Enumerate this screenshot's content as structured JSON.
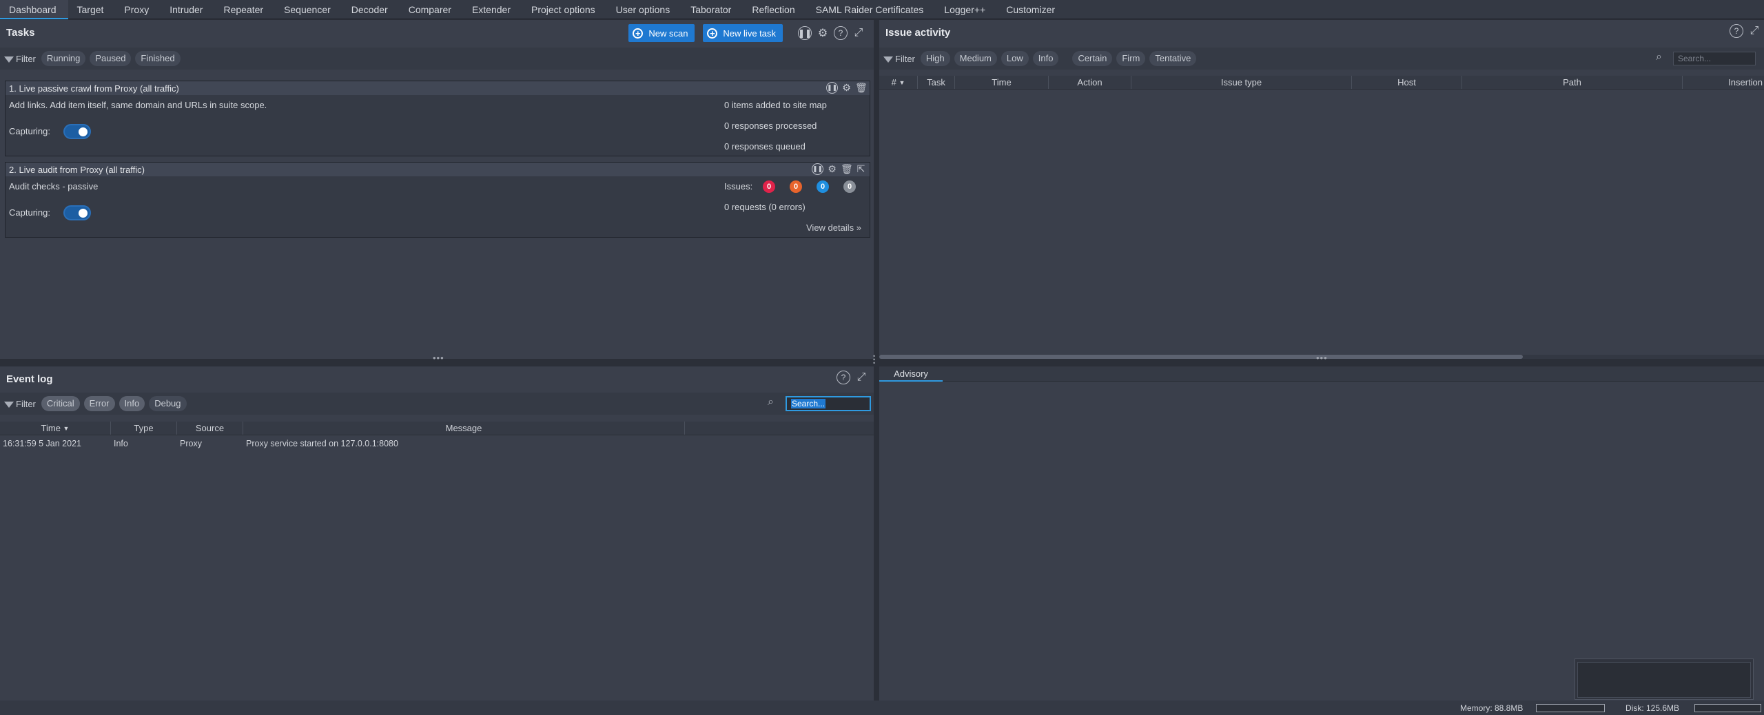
{
  "top_tabs": [
    "Dashboard",
    "Target",
    "Proxy",
    "Intruder",
    "Repeater",
    "Sequencer",
    "Decoder",
    "Comparer",
    "Extender",
    "Project options",
    "User options",
    "Taborator",
    "Reflection",
    "SAML Raider Certificates",
    "Logger++",
    "Customizer"
  ],
  "active_tab": "Dashboard",
  "tasks": {
    "title": "Tasks",
    "new_scan": "New scan",
    "new_live_task": "New live task",
    "filter_label": "Filter",
    "filters": [
      "Running",
      "Paused",
      "Finished"
    ],
    "items": [
      {
        "title": "1. Live passive crawl from Proxy (all traffic)",
        "description": "Add links. Add item itself, same domain and URLs in suite scope.",
        "capturing_label": "Capturing:",
        "stats": [
          "0 items added to site map",
          "0 responses processed",
          "0 responses queued"
        ]
      },
      {
        "title": "2. Live audit from Proxy (all traffic)",
        "description": "Audit checks - passive",
        "capturing_label": "Capturing:",
        "issues_label": "Issues:",
        "issue_counts": [
          "0",
          "0",
          "0",
          "0"
        ],
        "issue_colors": [
          "#e0234a",
          "#e8642c",
          "#1f8fe0",
          "#8a9099"
        ],
        "requests": "0 requests (0 errors)",
        "view_details": "View details"
      }
    ]
  },
  "issue_activity": {
    "title": "Issue activity",
    "filter_label": "Filter",
    "severity_filters": [
      "High",
      "Medium",
      "Low",
      "Info"
    ],
    "confidence_filters": [
      "Certain",
      "Firm",
      "Tentative"
    ],
    "search_placeholder": "Search...",
    "columns": [
      "#",
      "Task",
      "Time",
      "Action",
      "Issue type",
      "Host",
      "Path",
      "Insertion"
    ]
  },
  "event_log": {
    "title": "Event log",
    "filter_label": "Filter",
    "filters": [
      "Critical",
      "Error",
      "Info",
      "Debug"
    ],
    "search_value": "Search...",
    "columns": [
      "Time",
      "Type",
      "Source",
      "Message"
    ],
    "rows": [
      {
        "time": "16:31:59 5 Jan 2021",
        "type": "Info",
        "source": "Proxy",
        "message": "Proxy service started on 127.0.0.1:8080"
      }
    ]
  },
  "advisory": {
    "tab": "Advisory"
  },
  "status": {
    "memory": "Memory: 88.8MB",
    "disk": "Disk: 125.6MB"
  },
  "colors": {
    "accent": "#1f79d1",
    "background": "#2b2f38",
    "panel": "#3a3f4b"
  }
}
